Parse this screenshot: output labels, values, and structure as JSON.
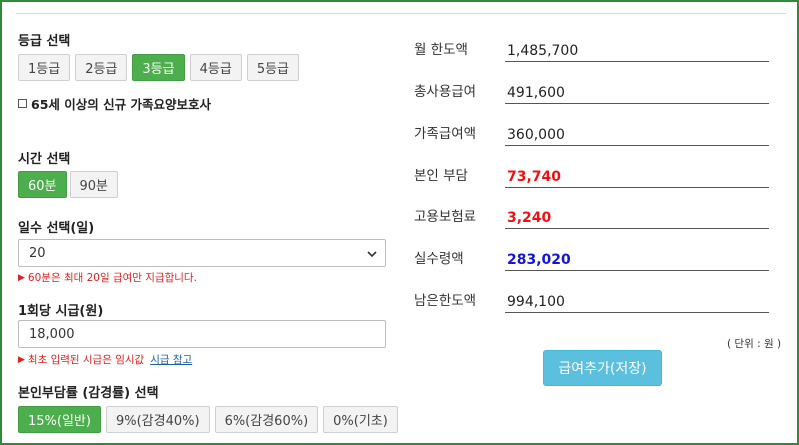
{
  "grade": {
    "label": "등급 선택",
    "options": [
      "1등급",
      "2등급",
      "3등급",
      "4등급",
      "5등급"
    ],
    "selected": "3등급"
  },
  "senior_checkbox": {
    "label": "65세 이상의 신규 가족요양보호사",
    "checked": false
  },
  "time": {
    "label": "시간 선택",
    "options": [
      "60분",
      "90분"
    ],
    "selected": "60분"
  },
  "days": {
    "label": "일수 선택(일)",
    "value": "20",
    "note": "60분은 최대 20일 급여만 지급합니다."
  },
  "hourly": {
    "label": "1회당 시급(원)",
    "value": "18,000",
    "note": "최초 입력된 시급은 임시값",
    "note_link": "시급 참고"
  },
  "copay": {
    "label": "본인부담률 (감경률) 선택",
    "options": [
      "15%(일반)",
      "9%(감경40%)",
      "6%(감경60%)",
      "0%(기초)"
    ],
    "selected": "15%(일반)"
  },
  "results": {
    "monthly_limit_label": "월 한도액",
    "monthly_limit": "1,485,700",
    "total_benefit_label": "총사용급여",
    "total_benefit": "491,600",
    "family_benefit_label": "가족급여액",
    "family_benefit": "360,000",
    "self_burden_label": "본인 부담",
    "self_burden": "73,740",
    "employment_ins_label": "고용보험료",
    "employment_ins": "3,240",
    "net_pay_label": "실수령액",
    "net_pay": "283,020",
    "remaining_label": "남은한도액",
    "remaining": "994,100"
  },
  "unit_text": "( 단위 : 원 )",
  "save_button": "급여추가(저장)",
  "colors": {
    "active": "#4cae4c",
    "frame": "#2f8a3a",
    "save": "#5bc0de",
    "red": "#ee1111",
    "blue": "#1515d8"
  }
}
